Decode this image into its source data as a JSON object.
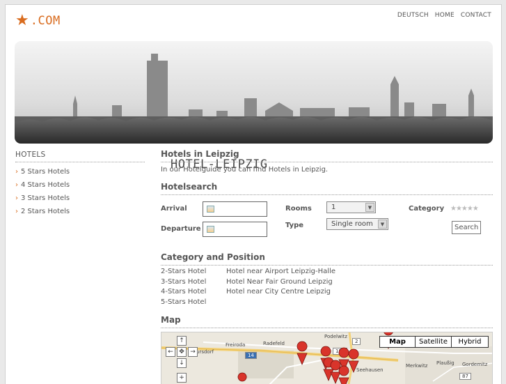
{
  "logo": {
    "main": "HOTEL-LEIPZIG",
    "tld": ".COM"
  },
  "topnav": [
    "DEUTSCH",
    "HOME",
    "CONTACT"
  ],
  "sidebar": {
    "title": "HOTELS",
    "items": [
      "5 Stars Hotels",
      "4 Stars Hotels",
      "3 Stars Hotels",
      "2 Stars Hotels"
    ]
  },
  "main": {
    "title": "Hotels in Leipzig",
    "intro": "In our Hotelguide you can find Hotels in Leipzig.",
    "search_title": "Hotelsearch",
    "arrival_label": "Arrival",
    "departure_label": "Departure",
    "rooms_label": "Rooms",
    "rooms_value": "1",
    "type_label": "Type",
    "type_value": "Single room",
    "category_label": "Category",
    "category_stars": "★★★★★",
    "search_button": "Search",
    "catpos_title": "Category and Position",
    "categories": [
      [
        "2-Stars Hotel",
        "Hotel near Airport Leipzig-Halle"
      ],
      [
        "3-Stars Hotel",
        "Hotel Near Fair Ground Leipzig"
      ],
      [
        "4-Stars Hotel",
        "Hotel near City Centre Leipzig"
      ],
      [
        "5-Stars Hotel",
        ""
      ]
    ],
    "map_title": "Map"
  },
  "map": {
    "types": [
      "Map",
      "Satellite",
      "Hybrid"
    ],
    "labels": [
      "Freiroda",
      "Radefeld",
      "Podelwitz",
      "Merkwitz",
      "Plaußig",
      "Gordemitz",
      "ursdorf",
      "Seehausen"
    ],
    "shields": [
      "184",
      "2",
      "14",
      "87"
    ]
  },
  "colors": {
    "accent": "#d96c1f",
    "marker": "#d9342b"
  }
}
